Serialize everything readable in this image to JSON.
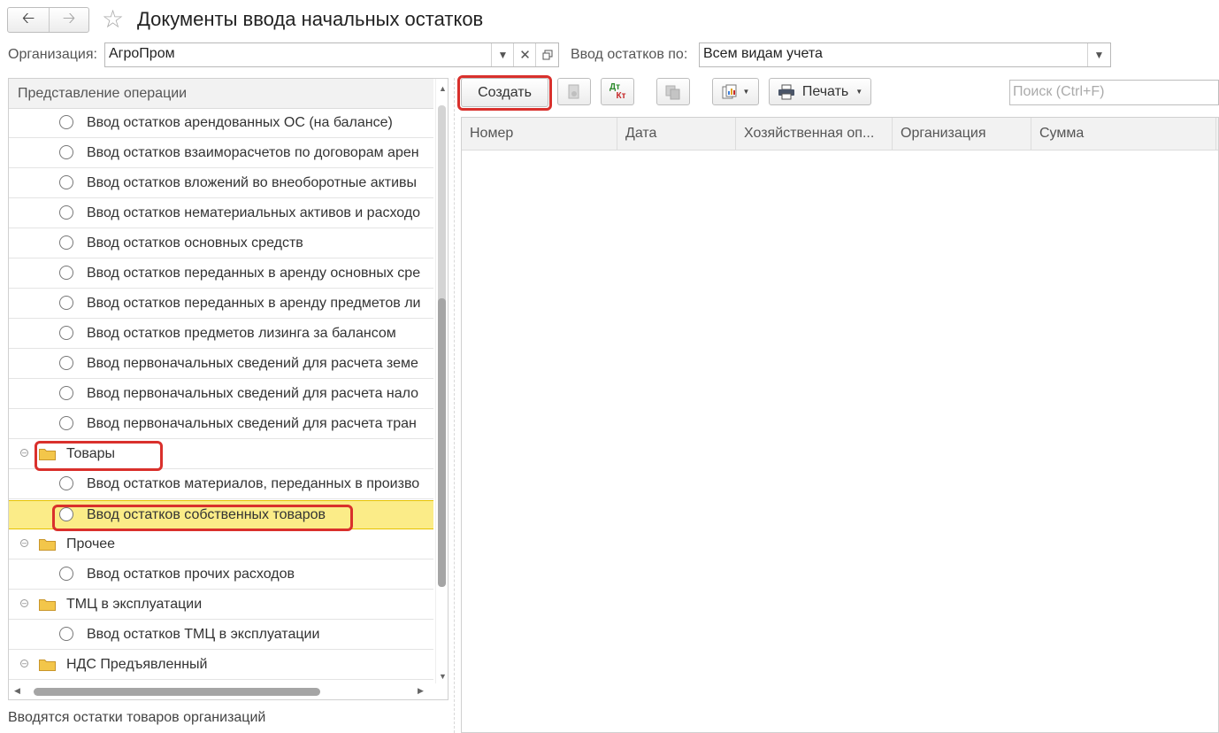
{
  "window": {
    "title": "Документы ввода начальных остатков"
  },
  "nav": {
    "back_icon": "arrow-left-icon",
    "forward_icon": "arrow-right-icon",
    "favorite_icon": "star-icon"
  },
  "filters": {
    "org_label": "Организация:",
    "org_value": "АгроПром",
    "input_by_label": "Ввод остатков по:",
    "input_by_value": "Всем видам учета"
  },
  "tree": {
    "header": "Представление операции",
    "rows": [
      {
        "type": "item",
        "label": "Ввод остатков арендованных ОС (на балансе)"
      },
      {
        "type": "item",
        "label": "Ввод остатков взаиморасчетов по договорам арен"
      },
      {
        "type": "item",
        "label": "Ввод остатков вложений во внеоборотные активы"
      },
      {
        "type": "item",
        "label": "Ввод остатков нематериальных активов и расходо"
      },
      {
        "type": "item",
        "label": "Ввод остатков основных средств"
      },
      {
        "type": "item",
        "label": "Ввод остатков переданных в аренду основных сре"
      },
      {
        "type": "item",
        "label": "Ввод остатков переданных в аренду предметов ли"
      },
      {
        "type": "item",
        "label": "Ввод остатков предметов лизинга за балансом"
      },
      {
        "type": "item",
        "label": "Ввод первоначальных сведений для расчета земе"
      },
      {
        "type": "item",
        "label": "Ввод первоначальных сведений для расчета нало"
      },
      {
        "type": "item",
        "label": "Ввод первоначальных сведений для расчета тран"
      },
      {
        "type": "group",
        "label": "Товары"
      },
      {
        "type": "item",
        "label": "Ввод остатков материалов, переданных в произво"
      },
      {
        "type": "item",
        "label": "Ввод остатков собственных товаров",
        "selected": true
      },
      {
        "type": "group",
        "label": "Прочее"
      },
      {
        "type": "item",
        "label": "Ввод остатков прочих расходов"
      },
      {
        "type": "group",
        "label": "ТМЦ в эксплуатации"
      },
      {
        "type": "item",
        "label": "Ввод остатков ТМЦ в эксплуатации"
      },
      {
        "type": "group",
        "label": "НДС Предъявленный"
      }
    ]
  },
  "status_text": "Вводятся остатки товаров организаций",
  "toolbar": {
    "create_label": "Создать",
    "dtkt_top": "Дт",
    "dtkt_bottom": "Кт",
    "print_label": "Печать",
    "search_placeholder": "Поиск (Ctrl+F)"
  },
  "grid": {
    "columns": [
      "Номер",
      "Дата",
      "Хозяйственная оп...",
      "Организация",
      "Сумма"
    ]
  },
  "colors": {
    "highlight": "#d9302c",
    "selected_row": "#fbec88",
    "folder": "#f3c64a"
  }
}
